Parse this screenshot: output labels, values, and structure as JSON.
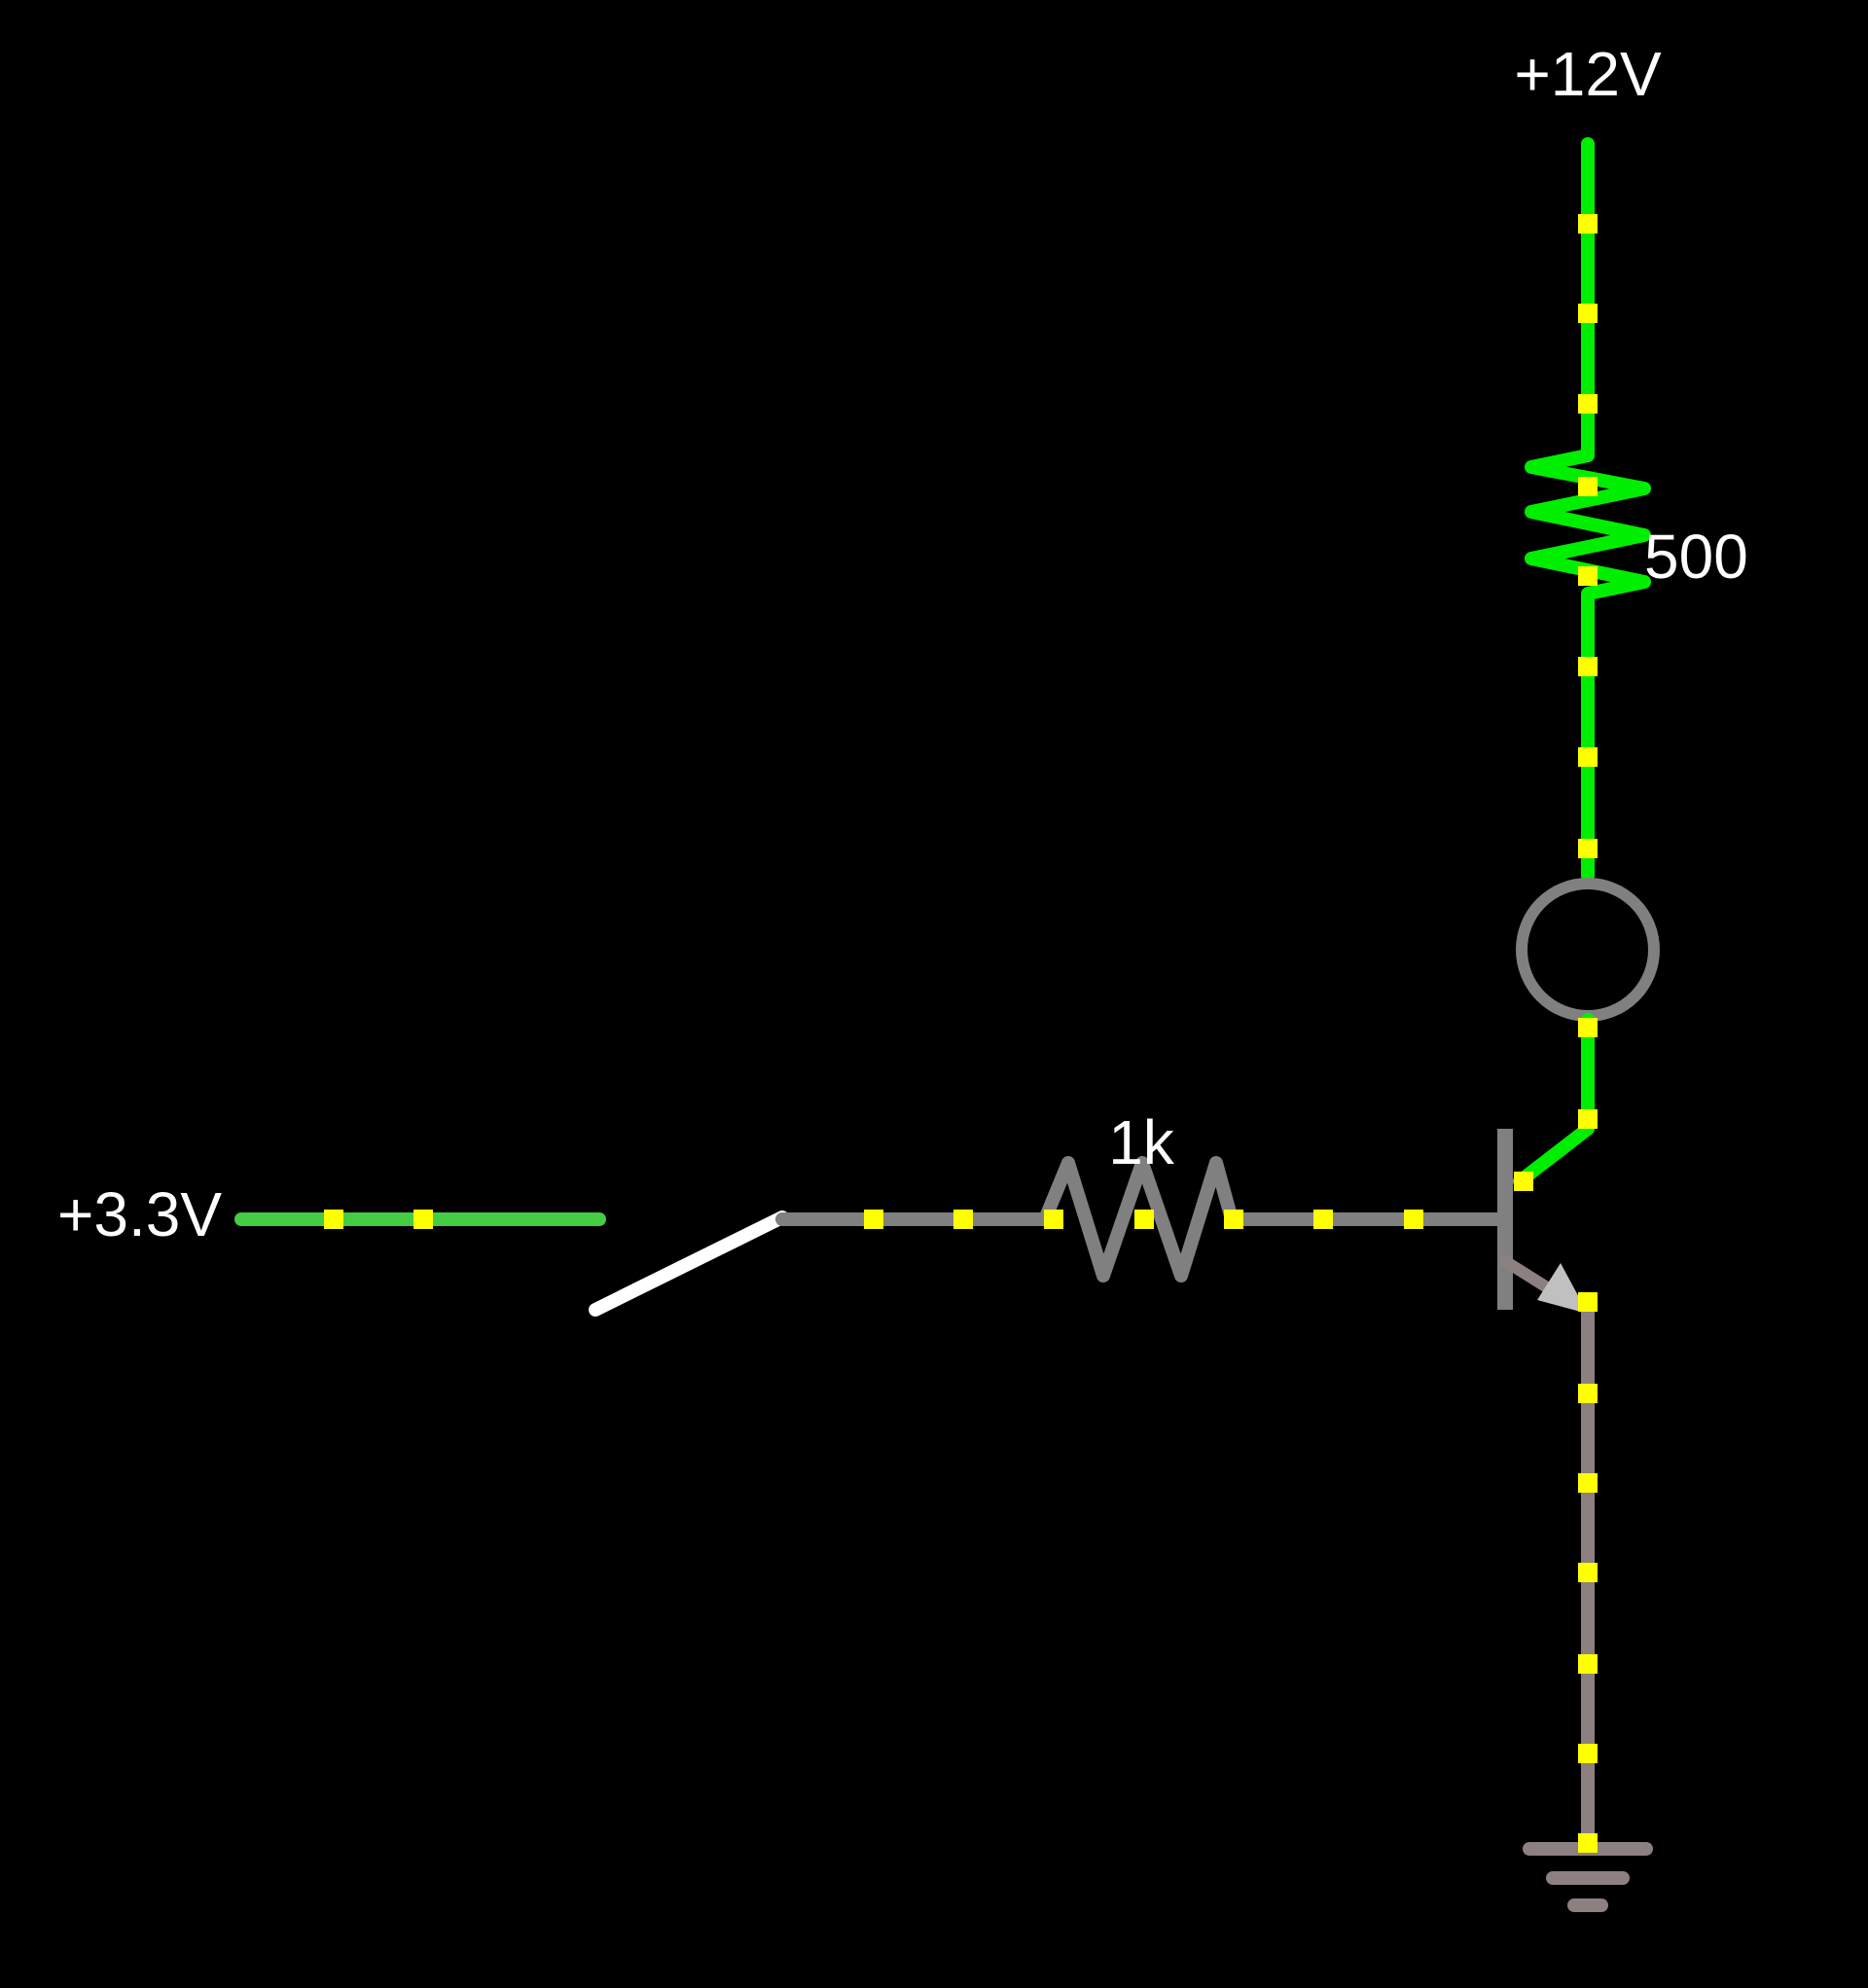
{
  "labels": {
    "supply_12v": "+12V",
    "supply_3v3": "+3.3V",
    "collector_resistor": "500",
    "base_resistor": "1k"
  },
  "colors": {
    "background": "#000000",
    "active_wire": "#00ee00",
    "input_wire": "#44cc44",
    "idle_wire": "#808080",
    "ground_wire": "#8c8080",
    "current_dot": "#ffff00",
    "switch_blade": "#ffffff",
    "lamp_ring": "#808080",
    "text": "#ffffff"
  },
  "components": {
    "switch": "open",
    "transistor": "npn",
    "lamp": "off"
  }
}
